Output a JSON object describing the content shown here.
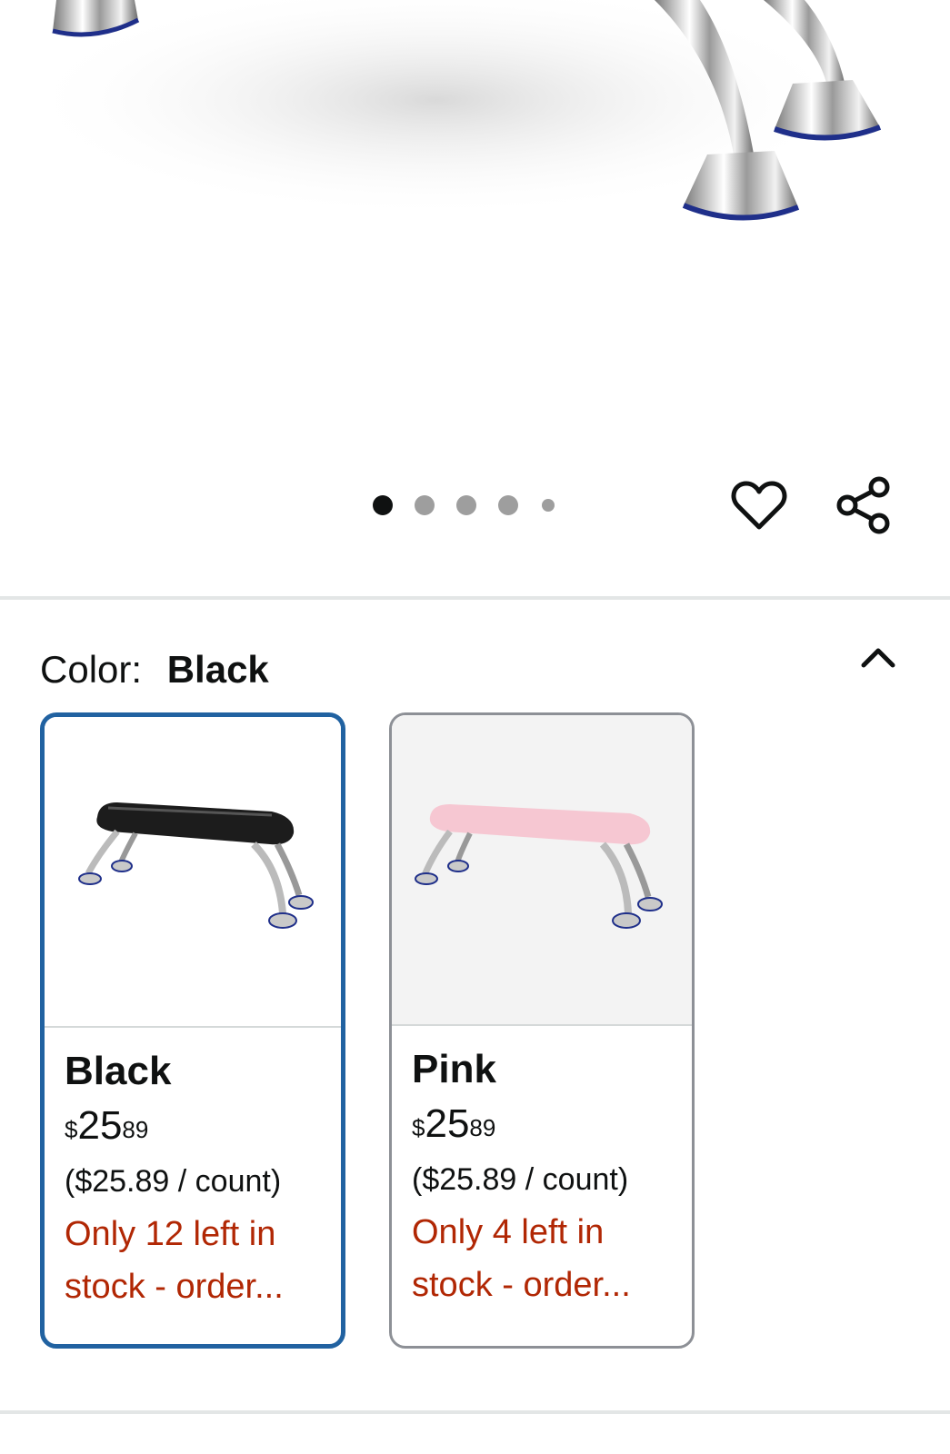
{
  "gallery": {
    "image_alt": "Nail arm rest product photo",
    "dots_total": 5,
    "active_index": 0
  },
  "actions": {
    "wishlist_icon": "heart-icon",
    "share_icon": "share-icon"
  },
  "color_section": {
    "label": "Color:",
    "selected_value": "Black",
    "collapse_icon": "chevron-up-icon"
  },
  "options": [
    {
      "name": "Black",
      "price_symbol": "$",
      "price_whole": "25",
      "price_fraction": "89",
      "unit_price": "($25.89 / count)",
      "stock_line1": "Only 12 left in",
      "stock_line2": "stock - order...",
      "swatch": "#1c1c1c",
      "selected": true
    },
    {
      "name": "Pink",
      "price_symbol": "$",
      "price_whole": "25",
      "price_fraction": "89",
      "unit_price": "($25.89 / count)",
      "stock_line1": "Only 4 left in",
      "stock_line2": "stock - order...",
      "swatch": "#f6c7d2",
      "selected": false
    }
  ],
  "colors": {
    "accent": "#2162a1",
    "stock_red": "#b12704"
  }
}
